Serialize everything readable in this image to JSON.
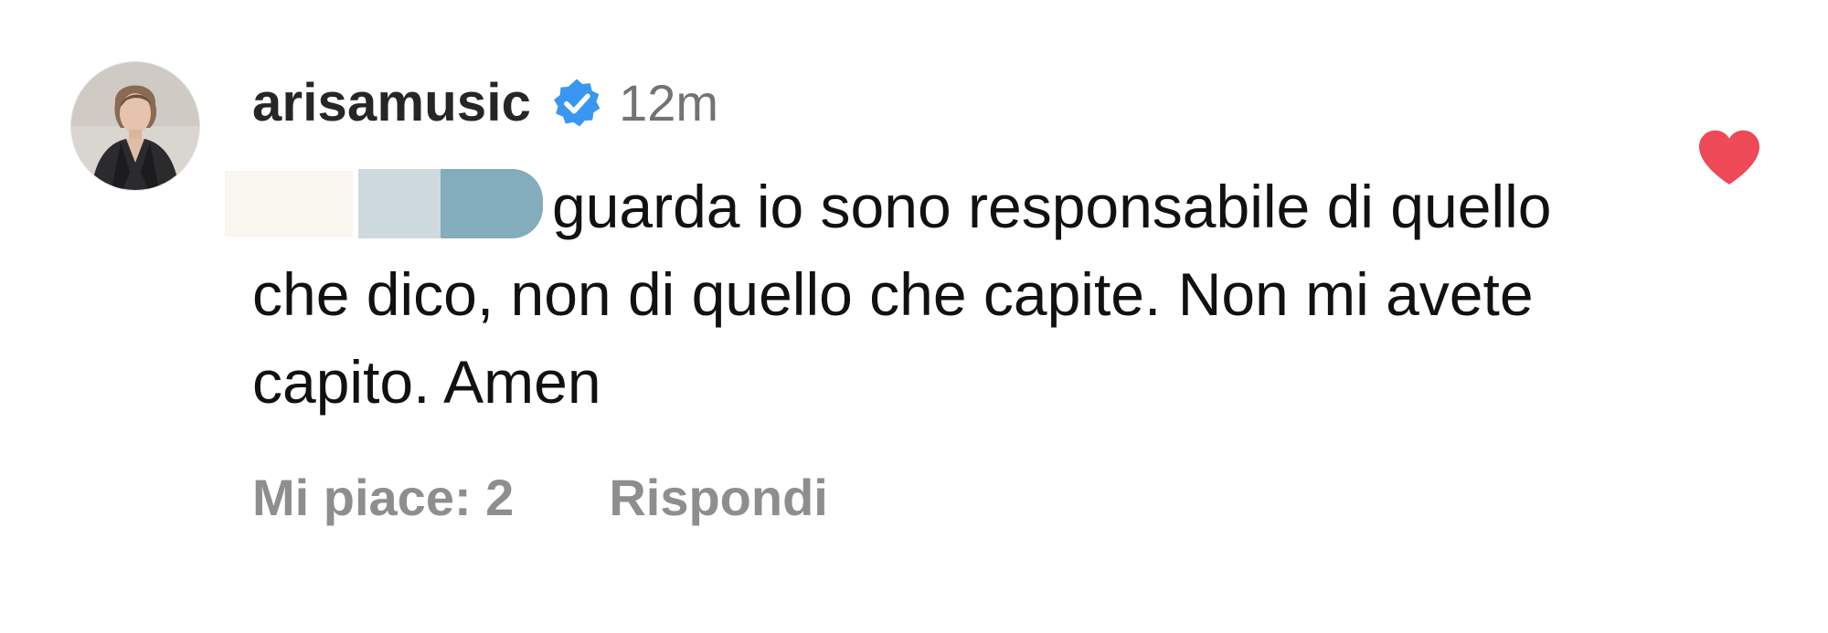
{
  "comment": {
    "username": "arisamusic",
    "verified": true,
    "time": "12m",
    "text": "guarda io sono responsabile di quello che dico, non di quello che capite. Non mi avete capito. Amen",
    "likes_label": "Mi piace: 2",
    "reply_label": "Rispondi",
    "liked": true
  },
  "colors": {
    "heart": "#ed4956",
    "verified_badge": "#3897f0",
    "meta_text": "#8e8e8e"
  },
  "icons": {
    "verified": "verified-badge-icon",
    "heart": "heart-filled-icon"
  }
}
